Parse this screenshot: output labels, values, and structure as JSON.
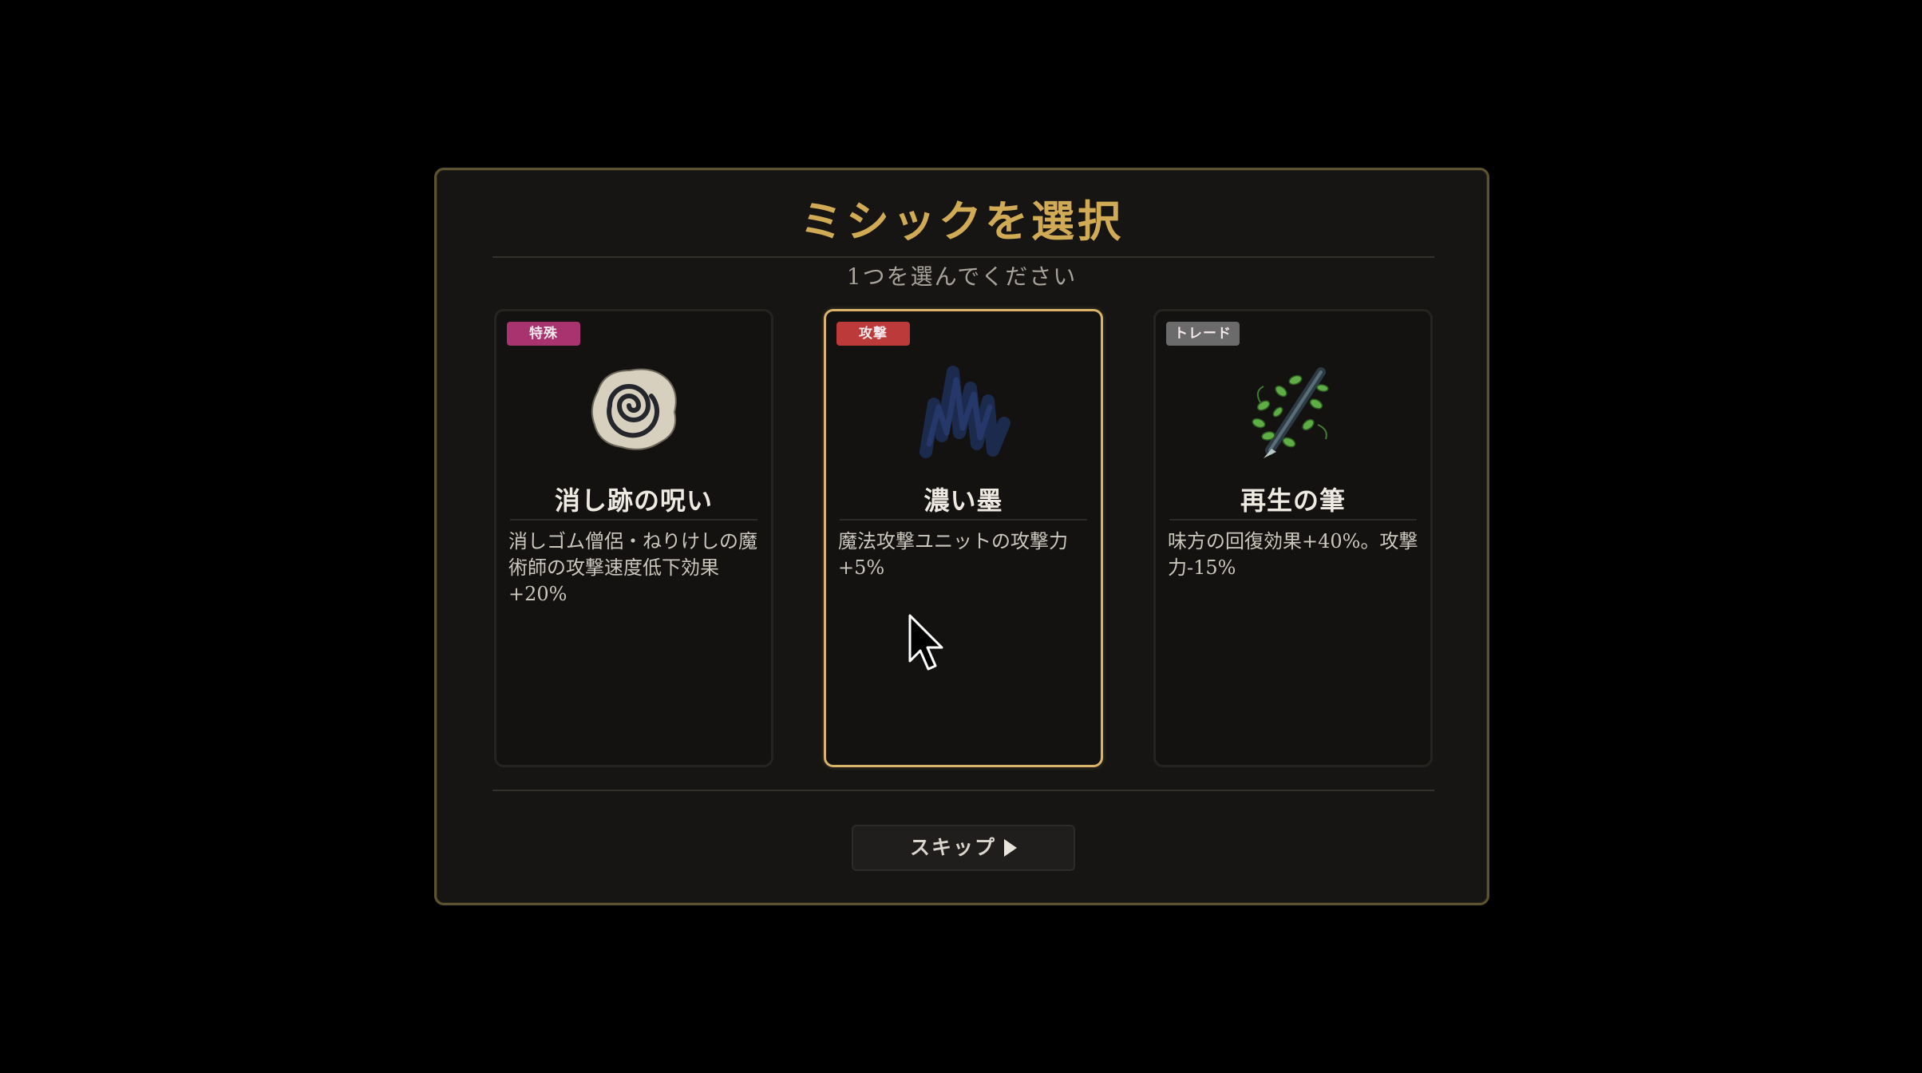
{
  "dialog": {
    "title": "ミシックを選択",
    "subtitle": "1つを選んでください",
    "skip_label": "スキップ"
  },
  "cards": [
    {
      "tag": "特殊",
      "tag_color": "#a8336f",
      "icon": "eraser-swirl-icon",
      "name": "消し跡の呪い",
      "description": "消しゴム僧侶・ねりけしの魔術師の攻撃速度低下効果+20%",
      "selected": false
    },
    {
      "tag": "攻撃",
      "tag_color": "#bd3a3a",
      "icon": "ink-scribble-icon",
      "name": "濃い墨",
      "description": "魔法攻撃ユニットの攻撃力+5%",
      "selected": true
    },
    {
      "tag": "トレード",
      "tag_color": "#6b6b6b",
      "icon": "leafy-pen-icon",
      "name": "再生の筆",
      "description": "味方の回復効果+40%。攻撃力-15%",
      "selected": false
    }
  ],
  "colors": {
    "accent_gold": "#d1aa55",
    "selected_border": "#d9b36a",
    "panel_bg": "#161513"
  }
}
